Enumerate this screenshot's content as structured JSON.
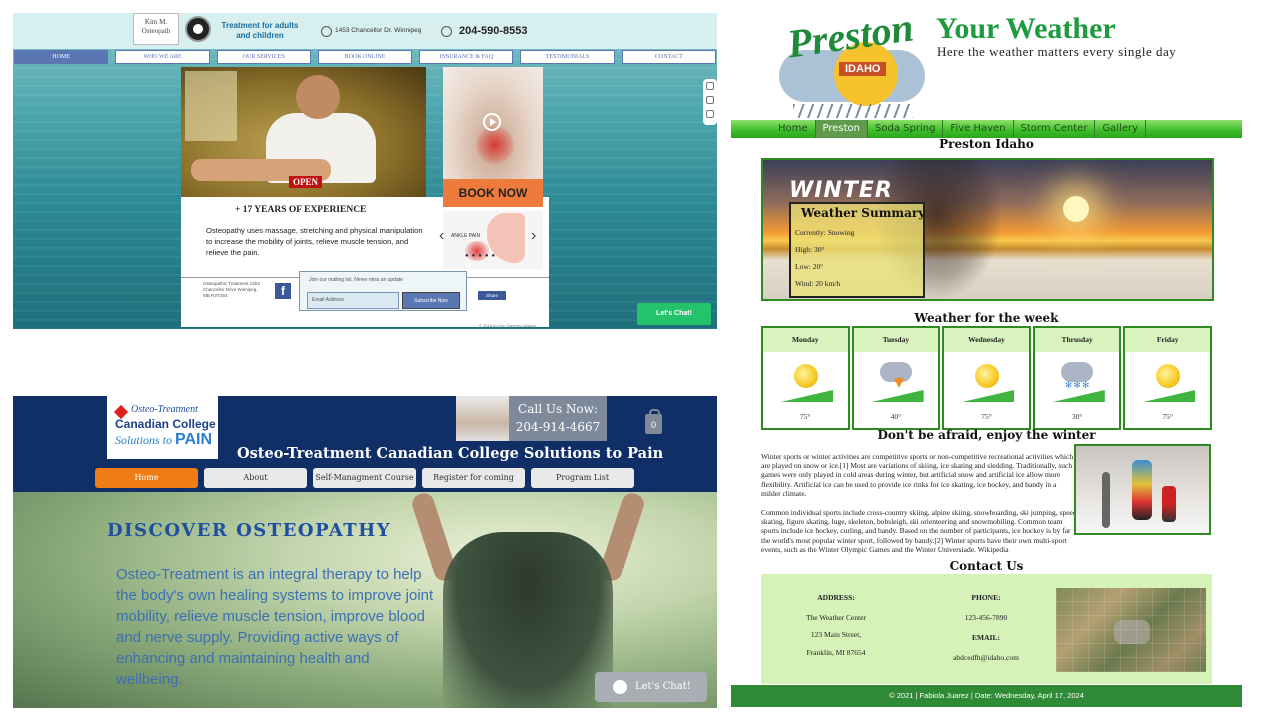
{
  "osteo_site": {
    "logo_text": "Kim M. Osteopath",
    "tagline": "Treatment for adults and children",
    "address": "1453 Chancellor Dr. Winnipeg",
    "phone": "204-590-8553",
    "nav": [
      "HOME",
      "WHO WE ARE",
      "OUR SERVICES",
      "BOOK ONLINE",
      "INSURANCE & FAQ",
      "TESTIMONIALS",
      "CONTACT"
    ],
    "open_badge": "OPEN",
    "experience_heading": "+ 17 YEARS OF EXPERIENCE",
    "description": "Osteopathy uses massage, stretching and physical manipulation to increase the mobility of joints, relieve muscle tension, and relieve the pain.",
    "book_button": "BOOK NOW",
    "ankle_label": "ANKLE PAIN",
    "footer_address": "Osteopathic Treatment 1453 Chancellor Drive Winnipeg, MB R3T4S4",
    "fb_icon": "f",
    "mailing_title": "Join our mailing list. Never miss an update",
    "email_placeholder": "Email Address",
    "subscribe_button": "Subscribe Now",
    "share_button": "Share",
    "copyright": "© 2018 by Kim Sanchez-Aldana",
    "chat_button": "Let's Chat!"
  },
  "weather_site": {
    "logo_word": "Preston",
    "logo_badge": "IDAHO",
    "title": "Your Weather",
    "subtitle": "Here the weather matters every single day",
    "nav": [
      "Home",
      "Preston",
      "Soda Spring",
      "Five Haven",
      "Storm Center",
      "Gallery"
    ],
    "page_heading": "Preston Idaho",
    "hero_word": "WINTER",
    "summary_title": "Weather Summary",
    "summary_lines": [
      "Currently: Snowing",
      "High: 30°",
      "Low: 20°",
      "Wind: 20 km/h"
    ],
    "week_heading": "Weather for the week",
    "week": [
      {
        "day": "Monday",
        "temp": "75°",
        "icon": "sun-icon"
      },
      {
        "day": "Tuesday",
        "temp": "40°",
        "icon": "storm-icon"
      },
      {
        "day": "Wednesday",
        "temp": "75°",
        "icon": "sun-icon"
      },
      {
        "day": "Thrusday",
        "temp": "30°",
        "icon": "snow-icon"
      },
      {
        "day": "Friday",
        "temp": "75°",
        "icon": "sun-icon"
      }
    ],
    "article_heading": "Don't be afraid, enjoy the winter",
    "para1": "Winter sports or winter activities are competitive sports or non-competitive recreational activities which are played on snow or ice.[1] Most are variations of skiing, ice skating and sledding. Traditionally, such games were only played in cold areas during winter, but artificial snow and artificial ice allow more flexibility. Artificial ice can be used to provide ice rinks for ice skating, ice hockey, and bandy in a milder climate.",
    "para2": "Common individual sports include cross-country skiing, alpine skiing, snowboarding, ski jumping, speed skating, figure skating, luge, skeleton, bobsleigh, ski orienteering and snowmobiling. Common team sports include ice hockey, curling, and bandy. Based on the number of participants, ice hockey is by far the world's most popular winter sport, followed by bandy.[2] Winter sports have their own multi-sport events, such as the Winter Olympic Games and the Winter Universiade. Wikipedia",
    "contact_heading": "Contact Us",
    "address_label": "ADDRESS:",
    "address_lines": [
      "The Weather Center",
      "123 Main Street,",
      "Franklin, MI 87654"
    ],
    "phone_label": "PHONE:",
    "phone": "123-456-7890",
    "email_label": "EMAIL:",
    "email": "abdcedfh@idaho.com",
    "footer": "© 2021 | Fabiola Juarez | Date: Wednesday, April 17, 2024"
  },
  "college_site": {
    "logo_line1": "Osteo-Treatment",
    "logo_line2": "Canadian College",
    "logo_line3": "Solutions to",
    "logo_line3b": "PAIN",
    "call_label": "Call Us Now:",
    "call_number": "204-914-4667",
    "cart_count": "0",
    "site_title": "Osteo-Treatment Canadian College Solutions to Pain",
    "nav": [
      "Home",
      "About",
      "Self-Managment Course",
      "Register for coming courses",
      "Program List"
    ],
    "hero_heading": "DISCOVER OSTEOPATHY",
    "hero_body": "Osteo-Treatment is an integral therapy to help the body's own healing systems to improve joint mobility, relieve muscle tension, improve blood and nerve supply. Providing active ways of enhancing and maintaining health and wellbeing.",
    "chat_button": "Let's Chat!"
  }
}
